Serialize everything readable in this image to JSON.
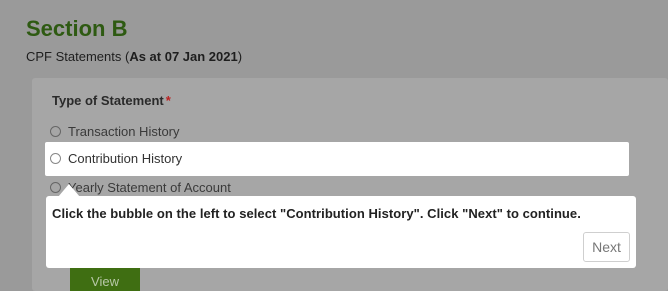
{
  "section": {
    "title": "Section B",
    "subtitle_prefix": "CPF Statements (",
    "subtitle_bold": "As at 07 Jan 2021",
    "subtitle_suffix": ")"
  },
  "form": {
    "type_label": "Type of Statement",
    "required_mark": "*",
    "options": [
      {
        "label": "Transaction History"
      },
      {
        "label": "Contribution History"
      },
      {
        "label": "Yearly Statement of Account"
      }
    ]
  },
  "tooltip": {
    "text": "Click the bubble on the left to select \"Contribution History\". Click \"Next\" to continue.",
    "next_label": "Next"
  },
  "view_button": {
    "label": "View"
  }
}
